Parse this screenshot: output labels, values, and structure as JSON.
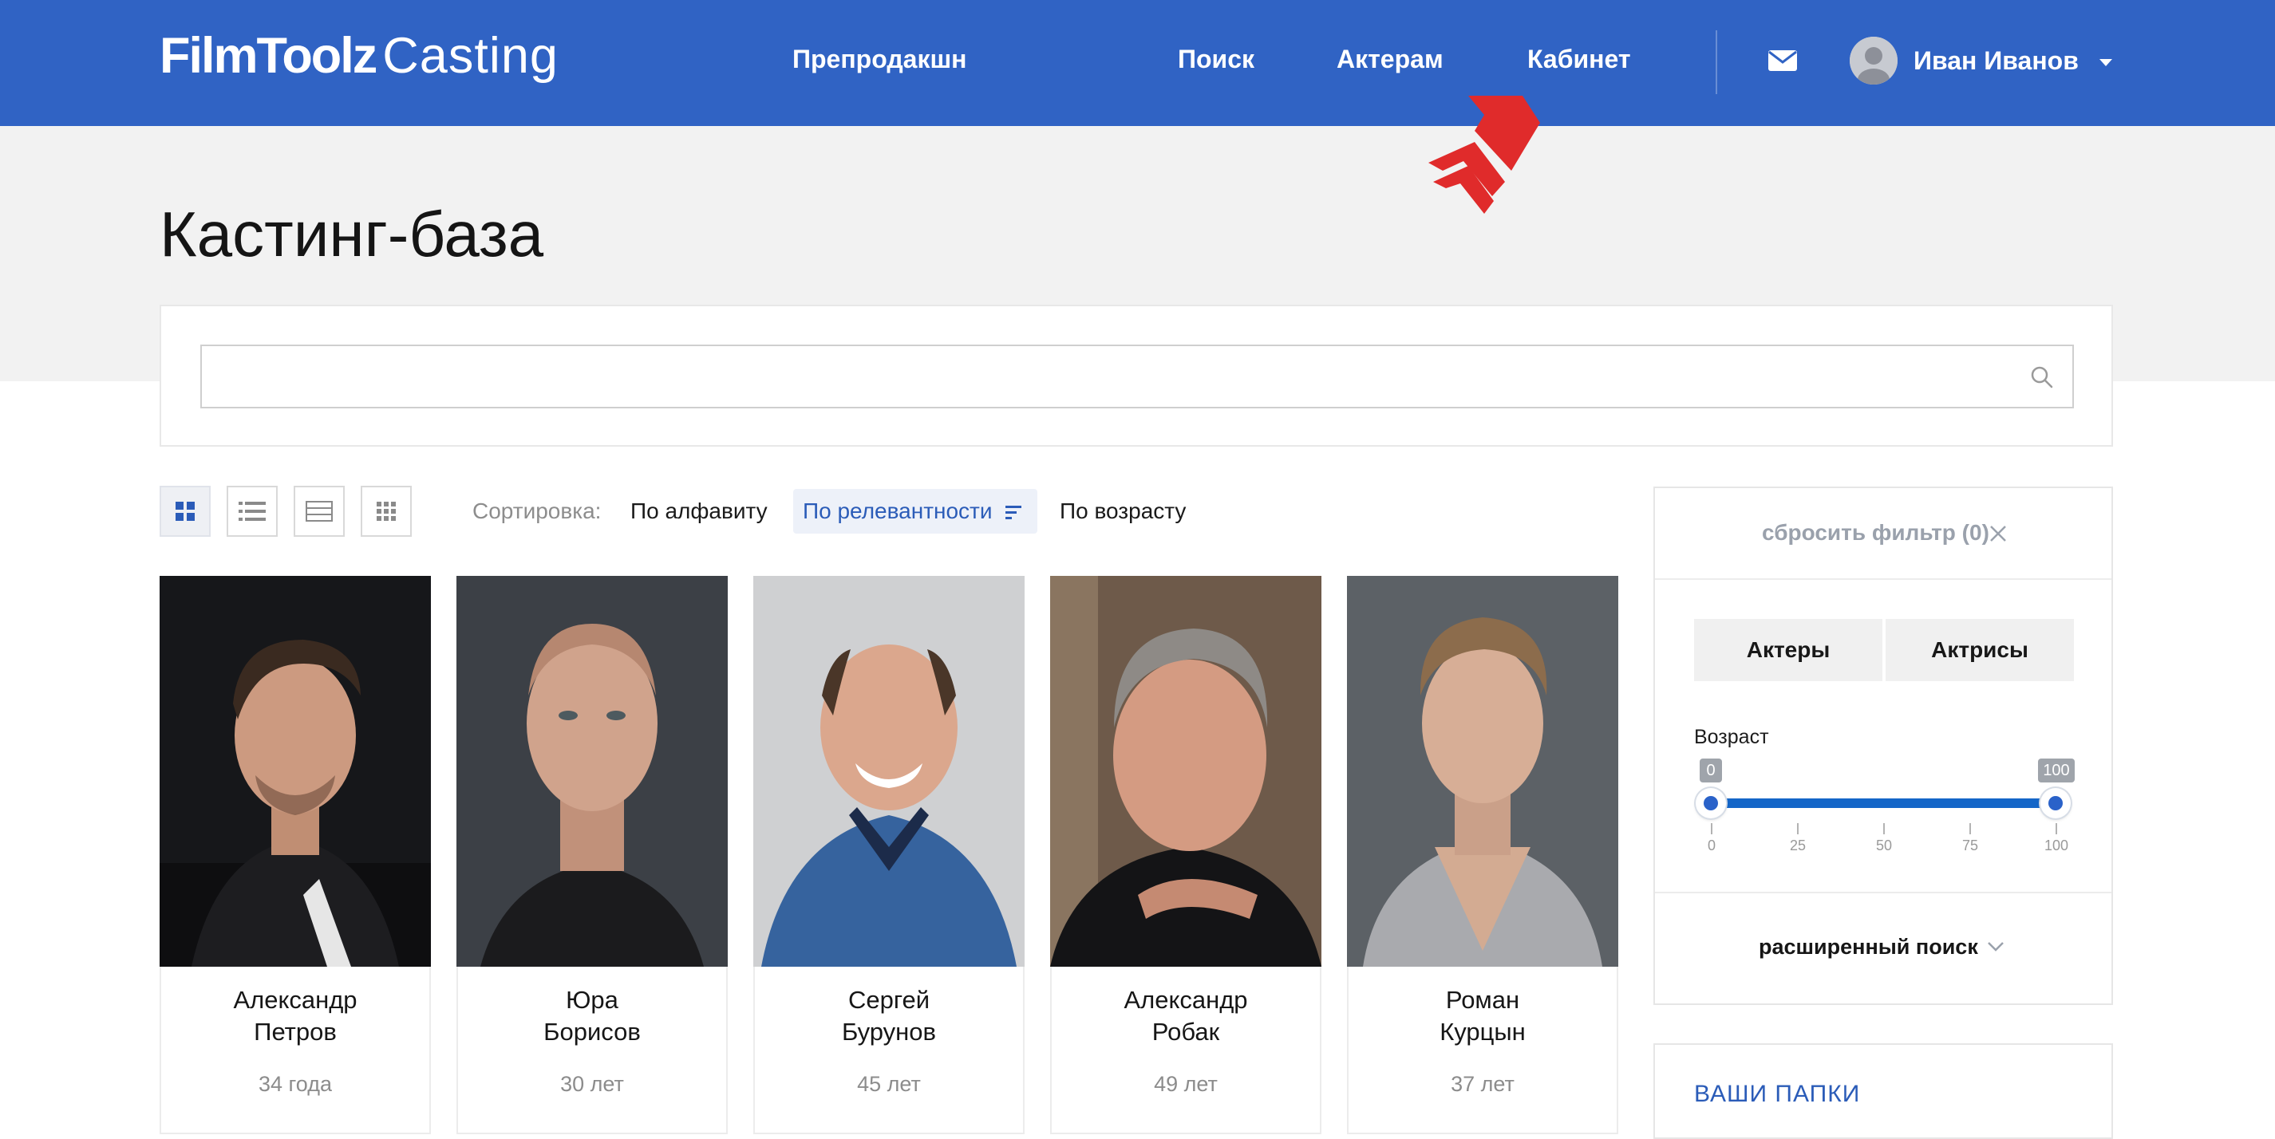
{
  "header": {
    "logo_brand": "FilmToolz",
    "logo_sub": "Casting",
    "nav": [
      "Препродакшн",
      "Поиск",
      "Актерам",
      "Кабинет"
    ],
    "mail_icon": "envelope-icon",
    "user_name": "Иван Иванов",
    "background_color": "#3063c4"
  },
  "page": {
    "title": "Кастинг-база"
  },
  "search": {
    "value": "",
    "placeholder": "",
    "icon": "search-icon"
  },
  "view_modes": [
    "grid-large",
    "list",
    "rows",
    "grid-small"
  ],
  "sorting": {
    "label": "Сортировка:",
    "options": [
      "По алфавиту",
      "По релевантности",
      "По возрасту"
    ],
    "active": "По релевантности"
  },
  "actors": [
    {
      "first_name": "Александр",
      "last_name": "Петров",
      "age": "34 года"
    },
    {
      "first_name": "Юра",
      "last_name": "Борисов",
      "age": "30 лет"
    },
    {
      "first_name": "Сергей",
      "last_name": "Бурунов",
      "age": "45 лет"
    },
    {
      "first_name": "Александр",
      "last_name": "Робак",
      "age": "49 лет"
    },
    {
      "first_name": "Роман",
      "last_name": "Курцын",
      "age": "37 лет"
    }
  ],
  "filter": {
    "reset_label": "сбросить фильтр (0)",
    "gender_buttons": [
      "Актеры",
      "Актрисы"
    ],
    "age": {
      "label": "Возраст",
      "min": 0,
      "max": 100,
      "min_badge": "0",
      "max_badge": "100",
      "ticks": [
        "0",
        "25",
        "50",
        "75",
        "100"
      ]
    },
    "advanced_search": "расширенный поиск"
  },
  "folders": {
    "title": "ВАШИ ПАПКИ"
  },
  "accent_color": "#2b5cb8"
}
